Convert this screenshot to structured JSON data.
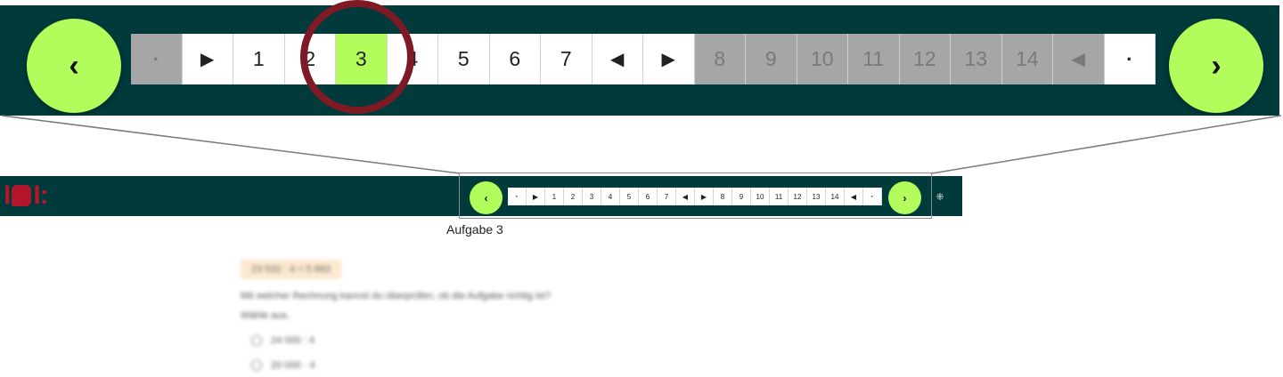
{
  "pagination": {
    "prev_glyph": "‹",
    "next_glyph": "›",
    "items": [
      {
        "label": "·",
        "state": "disabled",
        "kind": "dot"
      },
      {
        "label": "▶",
        "state": "normal",
        "kind": "tri"
      },
      {
        "label": "1",
        "state": "normal",
        "kind": "num"
      },
      {
        "label": "2",
        "state": "normal",
        "kind": "num"
      },
      {
        "label": "3",
        "state": "active",
        "kind": "num"
      },
      {
        "label": "4",
        "state": "normal",
        "kind": "num"
      },
      {
        "label": "5",
        "state": "normal",
        "kind": "num"
      },
      {
        "label": "6",
        "state": "normal",
        "kind": "num"
      },
      {
        "label": "7",
        "state": "normal",
        "kind": "num"
      },
      {
        "label": "◀",
        "state": "normal",
        "kind": "tri"
      },
      {
        "label": "▶",
        "state": "normal",
        "kind": "tri"
      },
      {
        "label": "8",
        "state": "disabled",
        "kind": "num"
      },
      {
        "label": "9",
        "state": "disabled",
        "kind": "num"
      },
      {
        "label": "10",
        "state": "disabled",
        "kind": "num"
      },
      {
        "label": "11",
        "state": "disabled",
        "kind": "num"
      },
      {
        "label": "12",
        "state": "disabled",
        "kind": "num"
      },
      {
        "label": "13",
        "state": "disabled",
        "kind": "num"
      },
      {
        "label": "14",
        "state": "disabled",
        "kind": "num"
      },
      {
        "label": "◀",
        "state": "disabled",
        "kind": "tri"
      },
      {
        "label": "·",
        "state": "normal",
        "kind": "dot"
      }
    ]
  },
  "logo": {
    "text": "I",
    "text_end": "I:"
  },
  "expand_glyph": "⁜",
  "task_label": "Aufgabe 3",
  "question": {
    "equation": "23 532 : 4 = 5 883",
    "text": "Mit welcher Rechnung kannst du überprüfen, ob die Aufgabe richtig ist?",
    "instruction": "Wähle aus.",
    "options": [
      "24 000 : 4",
      "20 000 · 4"
    ]
  },
  "colors": {
    "header_bg": "#003a3b",
    "accent_green": "#b2fd5c",
    "focus_ring": "#7d1a26",
    "disabled_cell": "#a6a6a6",
    "logo_red": "#b3152a"
  }
}
